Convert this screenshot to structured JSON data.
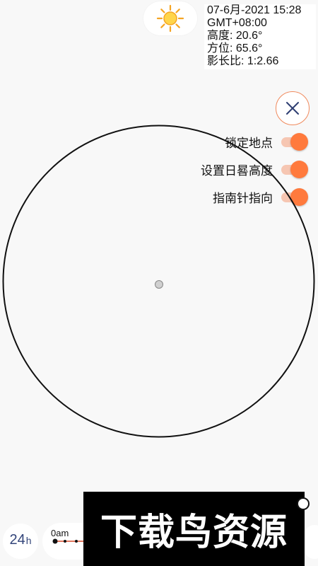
{
  "info": {
    "datetime": "07-6月-2021 15:28",
    "timezone": "GMT+08:00",
    "altitude": "高度: 20.6°",
    "azimuth": "方位: 65.6°",
    "shadow_ratio": "影长比: 1:2.66"
  },
  "sun_icon": "sun-icon",
  "close_icon": "close-icon",
  "toggles": [
    {
      "label": "锁定地点",
      "on": true
    },
    {
      "label": "设置日晷高度",
      "on": true
    },
    {
      "label": "指南针指向",
      "on": true
    }
  ],
  "colors": {
    "accent": "#ff7a3d",
    "accent_track": "#f6c6b2",
    "close_border": "#f08a5d",
    "close_x": "#2f3f73",
    "hours_text": "#33457a",
    "sun_orange": "#f5a524",
    "sun_yellow": "#ffd54a"
  },
  "bottom": {
    "hours_number": "24",
    "hours_unit": "h",
    "timeline_start": "0am"
  },
  "banner": {
    "text": "下载鸟资源"
  }
}
